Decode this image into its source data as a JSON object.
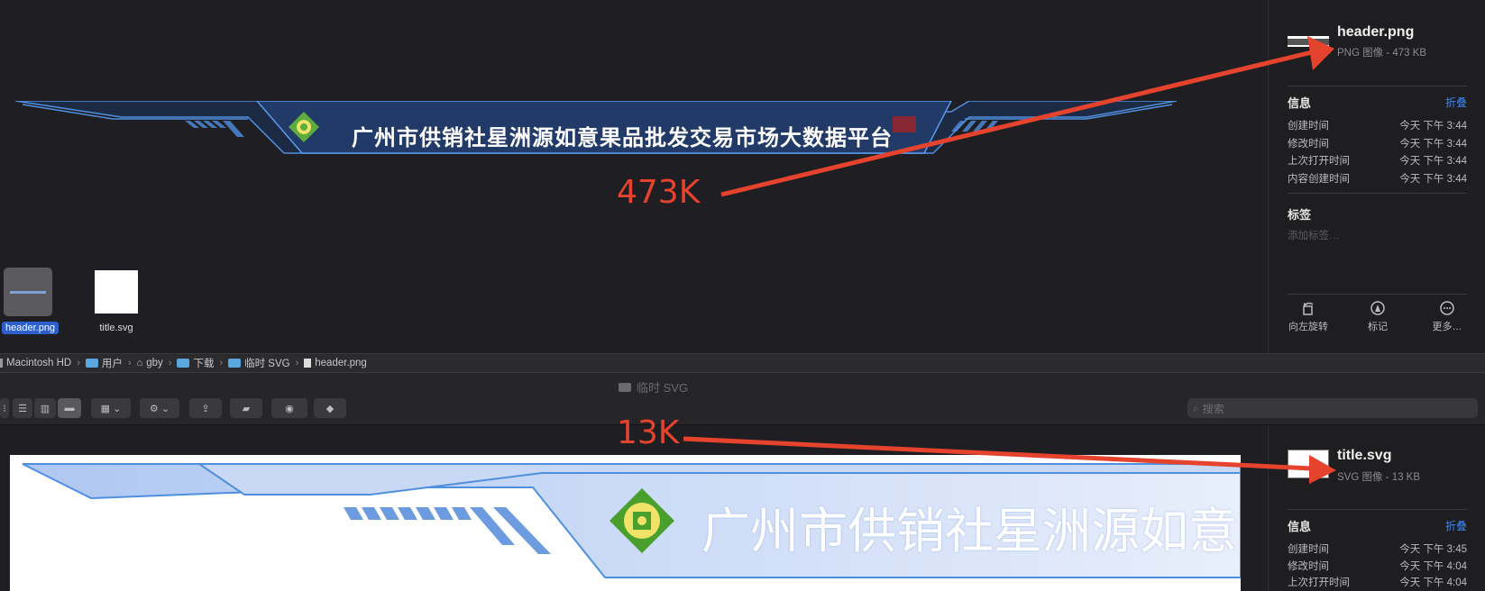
{
  "top_window": {
    "banner_title": "广州市供销社星洲源如意果品批发交易市场大数据平台",
    "size_annotation": "473K",
    "files": [
      {
        "name": "header.png",
        "selected": true
      },
      {
        "name": "title.svg",
        "selected": false
      }
    ],
    "inspector": {
      "file_name": "header.png",
      "file_info": "PNG 图像 - 473 KB",
      "info_heading": "信息",
      "collapse_label": "折叠",
      "rows": [
        {
          "label": "创建时间",
          "value": "今天 下午 3:44"
        },
        {
          "label": "修改时间",
          "value": "今天 下午 3:44"
        },
        {
          "label": "上次打开时间",
          "value": "今天 下午 3:44"
        },
        {
          "label": "内容创建时间",
          "value": "今天 下午 3:44"
        }
      ],
      "tags_heading": "标签",
      "tags_placeholder": "添加标签…",
      "actions": [
        {
          "label": "向左旋转",
          "icon": "rotate-left-icon"
        },
        {
          "label": "标记",
          "icon": "markup-icon"
        },
        {
          "label": "更多…",
          "icon": "more-icon"
        }
      ]
    },
    "path": [
      "Macintosh HD",
      "用户",
      "gby",
      "下载",
      "临时 SVG",
      "header.png"
    ]
  },
  "bottom_window": {
    "window_title": "临时 SVG",
    "search_placeholder": "搜索",
    "size_annotation": "13K",
    "banner_title": "广州市供销社星洲源如意",
    "inspector": {
      "file_name": "title.svg",
      "file_info": "SVG 图像 - 13 KB",
      "info_heading": "信息",
      "collapse_label": "折叠",
      "rows": [
        {
          "label": "创建时间",
          "value": "今天 下午 3:45"
        },
        {
          "label": "修改时间",
          "value": "今天 下午 4:04"
        },
        {
          "label": "上次打开时间",
          "value": "今天 下午 4:04"
        }
      ]
    }
  },
  "colors": {
    "annotation_red": "#e5432d",
    "selection_blue": "#2c5fcb",
    "link_blue": "#3b86f7",
    "banner_blue": "#4f8fe0"
  }
}
